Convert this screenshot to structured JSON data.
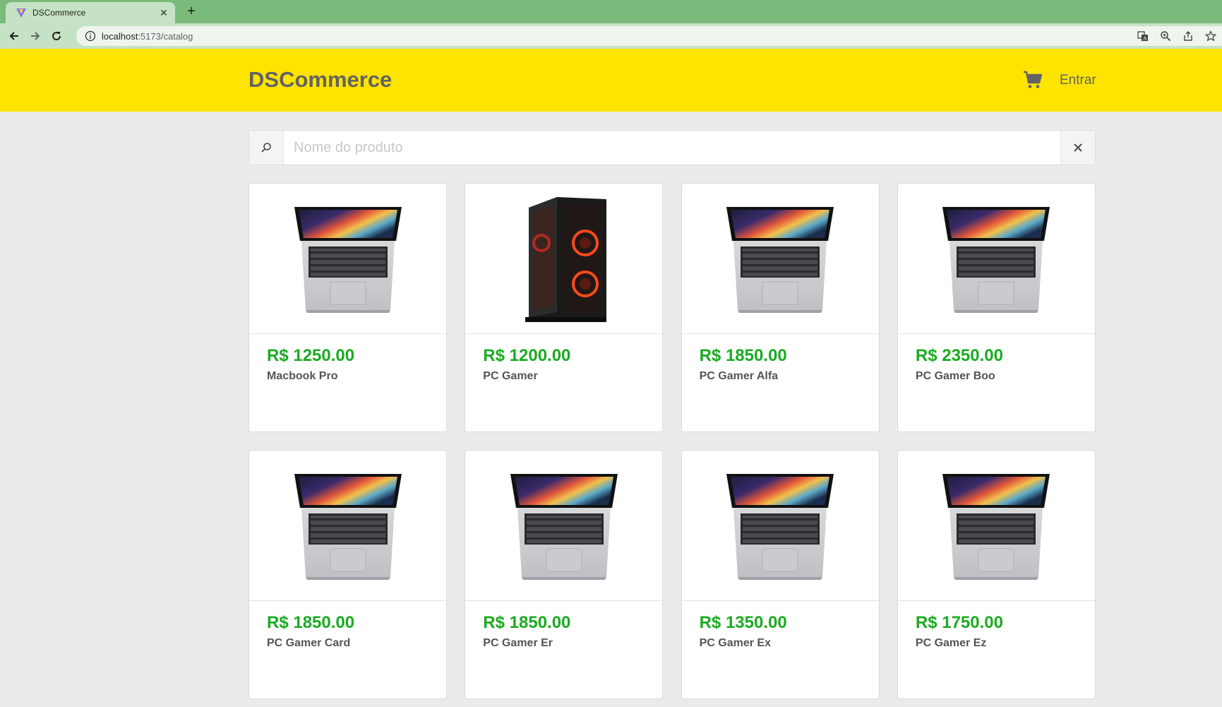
{
  "browser": {
    "tab_title": "DSCommerce",
    "url_host": "localhost",
    "url_port": ":5173",
    "url_path": "/catalog"
  },
  "header": {
    "brand": "DSCommerce",
    "login_label": "Entrar"
  },
  "search": {
    "placeholder": "Nome do produto",
    "value": ""
  },
  "products": [
    {
      "price": "R$ 1250.00",
      "name": "Macbook Pro",
      "image": "laptop"
    },
    {
      "price": "R$ 1200.00",
      "name": "PC Gamer",
      "image": "pc-tower"
    },
    {
      "price": "R$ 1850.00",
      "name": "PC Gamer Alfa",
      "image": "laptop"
    },
    {
      "price": "R$ 2350.00",
      "name": "PC Gamer Boo",
      "image": "laptop"
    },
    {
      "price": "R$ 1850.00",
      "name": "PC Gamer Card",
      "image": "laptop"
    },
    {
      "price": "R$ 1850.00",
      "name": "PC Gamer Er",
      "image": "laptop"
    },
    {
      "price": "R$ 1350.00",
      "name": "PC Gamer Ex",
      "image": "laptop"
    },
    {
      "price": "R$ 1750.00",
      "name": "PC Gamer Ez",
      "image": "laptop"
    }
  ],
  "colors": {
    "header_bg": "#ffe400",
    "price": "#1bab22",
    "browser_frame": "#7aba7b"
  }
}
